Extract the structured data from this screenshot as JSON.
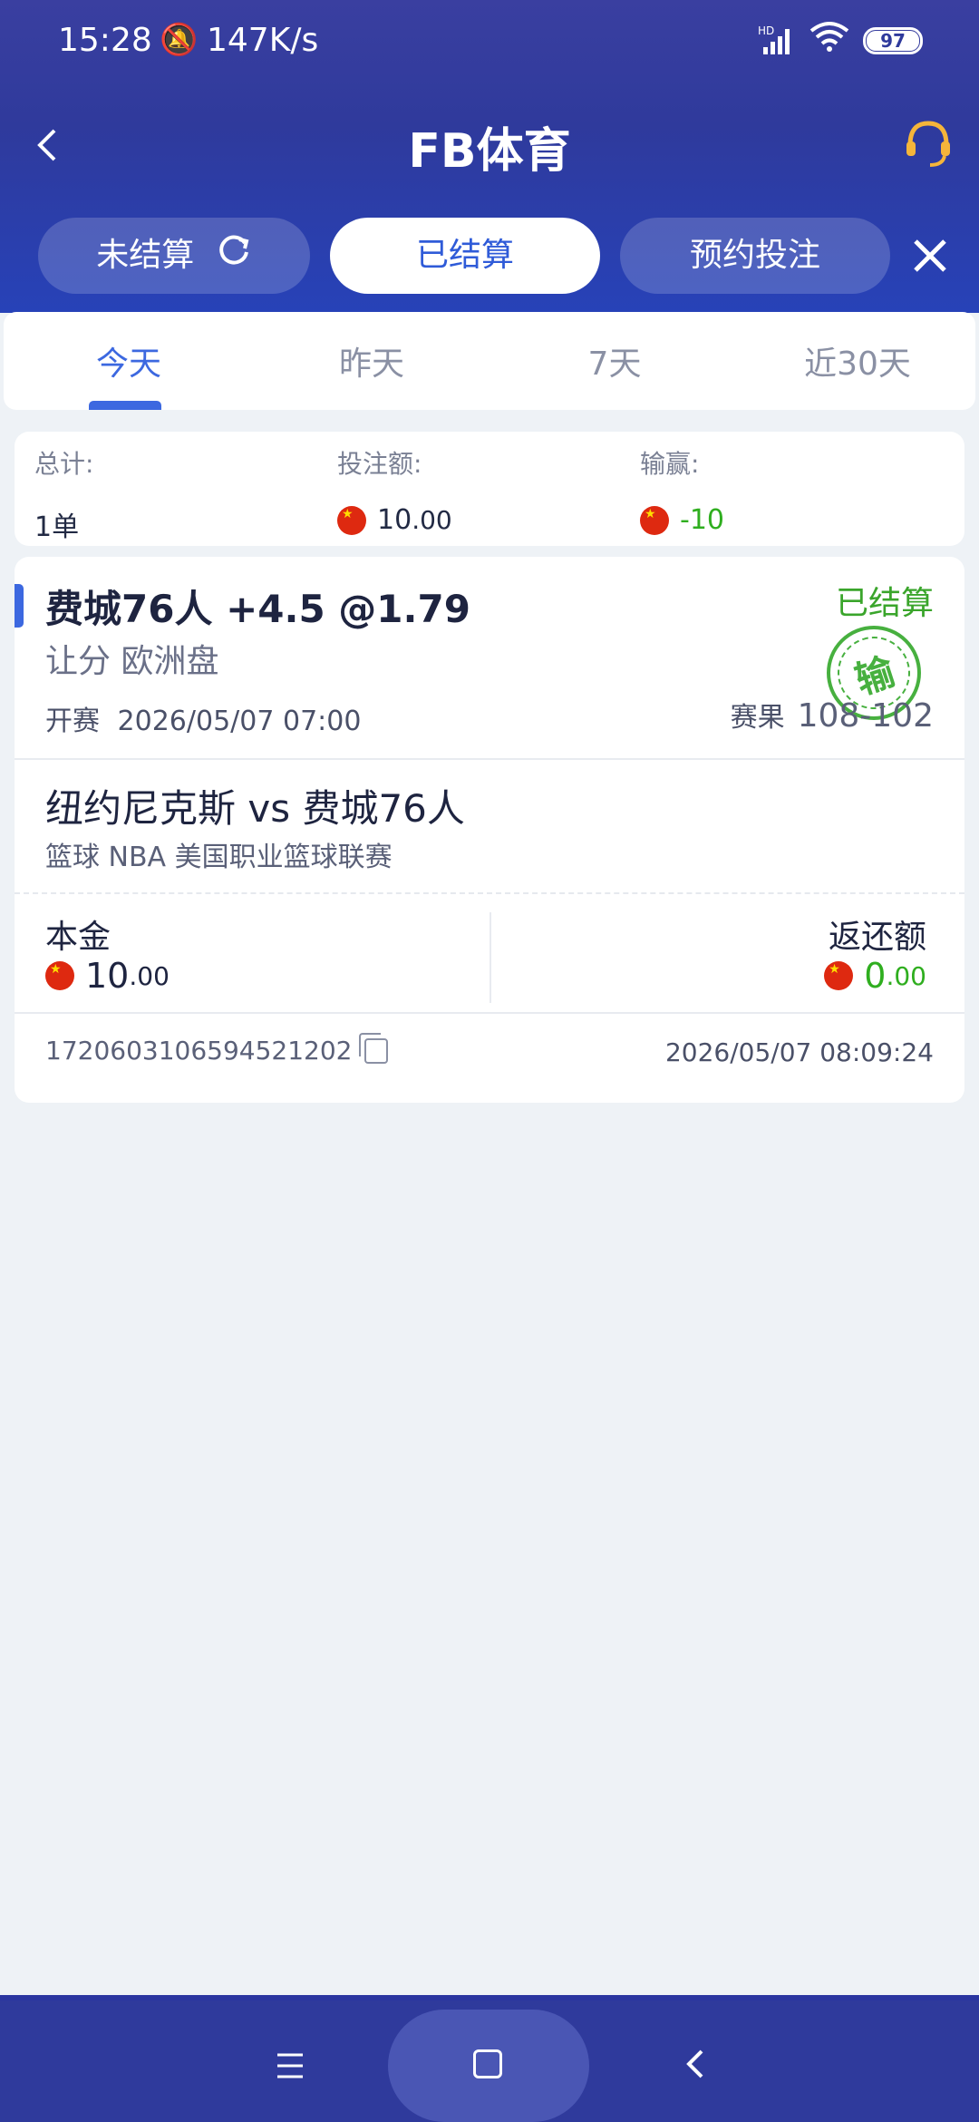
{
  "status_bar": {
    "time": "15:28",
    "speed": "147K/s",
    "battery": "97",
    "signal": "HD"
  },
  "header": {
    "title": "FB体育"
  },
  "segments": [
    {
      "label": "未结算"
    },
    {
      "label": "已结算"
    },
    {
      "label": "预约投注"
    }
  ],
  "tabs": [
    "今天",
    "昨天",
    "7天",
    "近30天"
  ],
  "summary": {
    "total_label": "总计:",
    "total_value": "1单",
    "stake_label": "投注额:",
    "stake_int": "10",
    "stake_dec": ".00",
    "winloss_label": "输赢:",
    "winloss_value": "-10"
  },
  "bet": {
    "title": "费城76人 +4.5 @1.79",
    "status": "已结算",
    "market": "让分 欧洲盘",
    "start_label": "开赛",
    "start_time": "2026/05/07 07:00",
    "result_label": "赛果",
    "score": "108-102",
    "stamp": "输",
    "match": "纽约尼克斯 vs 费城76人",
    "league": "篮球   NBA 美国职业篮球联赛",
    "principal_label": "本金",
    "principal_int": "10",
    "principal_dec": ".00",
    "return_label": "返还额",
    "return_int": "0",
    "return_dec": ".00",
    "order_id": "1720603106594521202",
    "order_time": "2026/05/07 08:09:24"
  },
  "colors": {
    "accent": "#3c68e0",
    "header": "#2f3a9c",
    "win_green": "#2fae1f"
  }
}
